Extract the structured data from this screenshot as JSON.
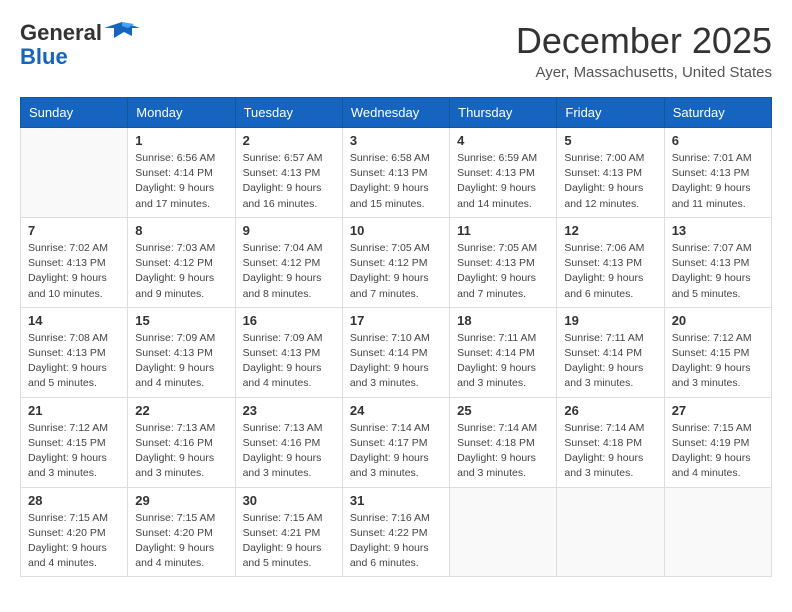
{
  "header": {
    "logo": {
      "general": "General",
      "blue": "Blue"
    },
    "title": "December 2025",
    "location": "Ayer, Massachusetts, United States"
  },
  "calendar": {
    "days_of_week": [
      "Sunday",
      "Monday",
      "Tuesday",
      "Wednesday",
      "Thursday",
      "Friday",
      "Saturday"
    ],
    "weeks": [
      [
        {
          "day": "",
          "empty": true
        },
        {
          "day": "1",
          "sunrise": "Sunrise: 6:56 AM",
          "sunset": "Sunset: 4:14 PM",
          "daylight": "Daylight: 9 hours and 17 minutes."
        },
        {
          "day": "2",
          "sunrise": "Sunrise: 6:57 AM",
          "sunset": "Sunset: 4:13 PM",
          "daylight": "Daylight: 9 hours and 16 minutes."
        },
        {
          "day": "3",
          "sunrise": "Sunrise: 6:58 AM",
          "sunset": "Sunset: 4:13 PM",
          "daylight": "Daylight: 9 hours and 15 minutes."
        },
        {
          "day": "4",
          "sunrise": "Sunrise: 6:59 AM",
          "sunset": "Sunset: 4:13 PM",
          "daylight": "Daylight: 9 hours and 14 minutes."
        },
        {
          "day": "5",
          "sunrise": "Sunrise: 7:00 AM",
          "sunset": "Sunset: 4:13 PM",
          "daylight": "Daylight: 9 hours and 12 minutes."
        },
        {
          "day": "6",
          "sunrise": "Sunrise: 7:01 AM",
          "sunset": "Sunset: 4:13 PM",
          "daylight": "Daylight: 9 hours and 11 minutes."
        }
      ],
      [
        {
          "day": "7",
          "sunrise": "Sunrise: 7:02 AM",
          "sunset": "Sunset: 4:13 PM",
          "daylight": "Daylight: 9 hours and 10 minutes."
        },
        {
          "day": "8",
          "sunrise": "Sunrise: 7:03 AM",
          "sunset": "Sunset: 4:12 PM",
          "daylight": "Daylight: 9 hours and 9 minutes."
        },
        {
          "day": "9",
          "sunrise": "Sunrise: 7:04 AM",
          "sunset": "Sunset: 4:12 PM",
          "daylight": "Daylight: 9 hours and 8 minutes."
        },
        {
          "day": "10",
          "sunrise": "Sunrise: 7:05 AM",
          "sunset": "Sunset: 4:12 PM",
          "daylight": "Daylight: 9 hours and 7 minutes."
        },
        {
          "day": "11",
          "sunrise": "Sunrise: 7:05 AM",
          "sunset": "Sunset: 4:13 PM",
          "daylight": "Daylight: 9 hours and 7 minutes."
        },
        {
          "day": "12",
          "sunrise": "Sunrise: 7:06 AM",
          "sunset": "Sunset: 4:13 PM",
          "daylight": "Daylight: 9 hours and 6 minutes."
        },
        {
          "day": "13",
          "sunrise": "Sunrise: 7:07 AM",
          "sunset": "Sunset: 4:13 PM",
          "daylight": "Daylight: 9 hours and 5 minutes."
        }
      ],
      [
        {
          "day": "14",
          "sunrise": "Sunrise: 7:08 AM",
          "sunset": "Sunset: 4:13 PM",
          "daylight": "Daylight: 9 hours and 5 minutes."
        },
        {
          "day": "15",
          "sunrise": "Sunrise: 7:09 AM",
          "sunset": "Sunset: 4:13 PM",
          "daylight": "Daylight: 9 hours and 4 minutes."
        },
        {
          "day": "16",
          "sunrise": "Sunrise: 7:09 AM",
          "sunset": "Sunset: 4:13 PM",
          "daylight": "Daylight: 9 hours and 4 minutes."
        },
        {
          "day": "17",
          "sunrise": "Sunrise: 7:10 AM",
          "sunset": "Sunset: 4:14 PM",
          "daylight": "Daylight: 9 hours and 3 minutes."
        },
        {
          "day": "18",
          "sunrise": "Sunrise: 7:11 AM",
          "sunset": "Sunset: 4:14 PM",
          "daylight": "Daylight: 9 hours and 3 minutes."
        },
        {
          "day": "19",
          "sunrise": "Sunrise: 7:11 AM",
          "sunset": "Sunset: 4:14 PM",
          "daylight": "Daylight: 9 hours and 3 minutes."
        },
        {
          "day": "20",
          "sunrise": "Sunrise: 7:12 AM",
          "sunset": "Sunset: 4:15 PM",
          "daylight": "Daylight: 9 hours and 3 minutes."
        }
      ],
      [
        {
          "day": "21",
          "sunrise": "Sunrise: 7:12 AM",
          "sunset": "Sunset: 4:15 PM",
          "daylight": "Daylight: 9 hours and 3 minutes."
        },
        {
          "day": "22",
          "sunrise": "Sunrise: 7:13 AM",
          "sunset": "Sunset: 4:16 PM",
          "daylight": "Daylight: 9 hours and 3 minutes."
        },
        {
          "day": "23",
          "sunrise": "Sunrise: 7:13 AM",
          "sunset": "Sunset: 4:16 PM",
          "daylight": "Daylight: 9 hours and 3 minutes."
        },
        {
          "day": "24",
          "sunrise": "Sunrise: 7:14 AM",
          "sunset": "Sunset: 4:17 PM",
          "daylight": "Daylight: 9 hours and 3 minutes."
        },
        {
          "day": "25",
          "sunrise": "Sunrise: 7:14 AM",
          "sunset": "Sunset: 4:18 PM",
          "daylight": "Daylight: 9 hours and 3 minutes."
        },
        {
          "day": "26",
          "sunrise": "Sunrise: 7:14 AM",
          "sunset": "Sunset: 4:18 PM",
          "daylight": "Daylight: 9 hours and 3 minutes."
        },
        {
          "day": "27",
          "sunrise": "Sunrise: 7:15 AM",
          "sunset": "Sunset: 4:19 PM",
          "daylight": "Daylight: 9 hours and 4 minutes."
        }
      ],
      [
        {
          "day": "28",
          "sunrise": "Sunrise: 7:15 AM",
          "sunset": "Sunset: 4:20 PM",
          "daylight": "Daylight: 9 hours and 4 minutes."
        },
        {
          "day": "29",
          "sunrise": "Sunrise: 7:15 AM",
          "sunset": "Sunset: 4:20 PM",
          "daylight": "Daylight: 9 hours and 4 minutes."
        },
        {
          "day": "30",
          "sunrise": "Sunrise: 7:15 AM",
          "sunset": "Sunset: 4:21 PM",
          "daylight": "Daylight: 9 hours and 5 minutes."
        },
        {
          "day": "31",
          "sunrise": "Sunrise: 7:16 AM",
          "sunset": "Sunset: 4:22 PM",
          "daylight": "Daylight: 9 hours and 6 minutes."
        },
        {
          "day": "",
          "empty": true
        },
        {
          "day": "",
          "empty": true
        },
        {
          "day": "",
          "empty": true
        }
      ]
    ]
  }
}
